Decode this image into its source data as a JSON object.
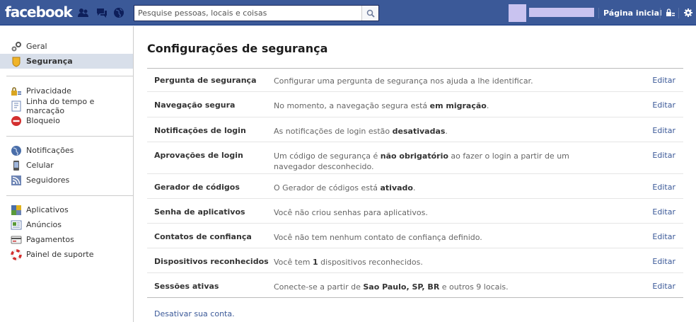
{
  "header": {
    "logo": "facebook",
    "search_placeholder": "Pesquise pessoas, locais e coisas",
    "home_label": "Página inicial",
    "jewels": [
      "friend-requests-icon",
      "messages-icon",
      "notifications-globe-icon"
    ],
    "right_icons": [
      "privacy-lock-icon",
      "settings-gear-icon"
    ]
  },
  "sidebar": {
    "groups": [
      [
        {
          "label": "Geral",
          "icon": "gears-icon"
        },
        {
          "label": "Segurança",
          "icon": "security-badge-icon",
          "active": true
        }
      ],
      [
        {
          "label": "Privacidade",
          "icon": "privacy-lock-icon"
        },
        {
          "label": "Linha do tempo e marcação",
          "icon": "timeline-icon"
        },
        {
          "label": "Bloqueio",
          "icon": "block-icon"
        }
      ],
      [
        {
          "label": "Notificações",
          "icon": "globe-icon"
        },
        {
          "label": "Celular",
          "icon": "mobile-phone-icon"
        },
        {
          "label": "Seguidores",
          "icon": "rss-icon"
        }
      ],
      [
        {
          "label": "Aplicativos",
          "icon": "apps-cube-icon"
        },
        {
          "label": "Anúncios",
          "icon": "ads-icon"
        },
        {
          "label": "Pagamentos",
          "icon": "credit-card-icon"
        },
        {
          "label": "Painel de suporte",
          "icon": "lifebuoy-icon"
        }
      ]
    ]
  },
  "main": {
    "title": "Configurações de segurança",
    "edit_label": "Editar",
    "rows": [
      {
        "label": "Pergunta de segurança",
        "desc": [
          {
            "t": "Configurar uma pergunta de segurança nos ajuda a lhe identificar."
          }
        ]
      },
      {
        "label": "Navegação segura",
        "desc": [
          {
            "t": "No momento, a navegação segura está "
          },
          {
            "t": "em migração",
            "b": true
          },
          {
            "t": "."
          }
        ]
      },
      {
        "label": "Notificações de login",
        "desc": [
          {
            "t": "As notificações de login estão "
          },
          {
            "t": "desativadas",
            "b": true
          },
          {
            "t": "."
          }
        ]
      },
      {
        "label": "Aprovações de login",
        "desc": [
          {
            "t": "Um código de segurança é "
          },
          {
            "t": "não obrigatório",
            "b": true
          },
          {
            "t": " ao fazer o login a partir de um navegador desconhecido."
          }
        ]
      },
      {
        "label": "Gerador de códigos",
        "desc": [
          {
            "t": "O Gerador de códigos está "
          },
          {
            "t": "ativado",
            "b": true
          },
          {
            "t": "."
          }
        ]
      },
      {
        "label": "Senha de aplicativos",
        "desc": [
          {
            "t": "Você não criou senhas para aplicativos."
          }
        ]
      },
      {
        "label": "Contatos de confiança",
        "desc": [
          {
            "t": "Você não tem nenhum contato de confiança definido."
          }
        ]
      },
      {
        "label": "Dispositivos reconhecidos",
        "desc": [
          {
            "t": "Você tem "
          },
          {
            "t": "1",
            "b": true
          },
          {
            "t": " dispositivos reconhecidos."
          }
        ]
      },
      {
        "label": "Sessões ativas",
        "desc": [
          {
            "t": "Conecte-se a partir de "
          },
          {
            "t": "Sao Paulo, SP, BR",
            "b": true
          },
          {
            "t": " e outros 9 locais."
          }
        ]
      }
    ],
    "deactivate_label": "Desativar sua conta."
  }
}
